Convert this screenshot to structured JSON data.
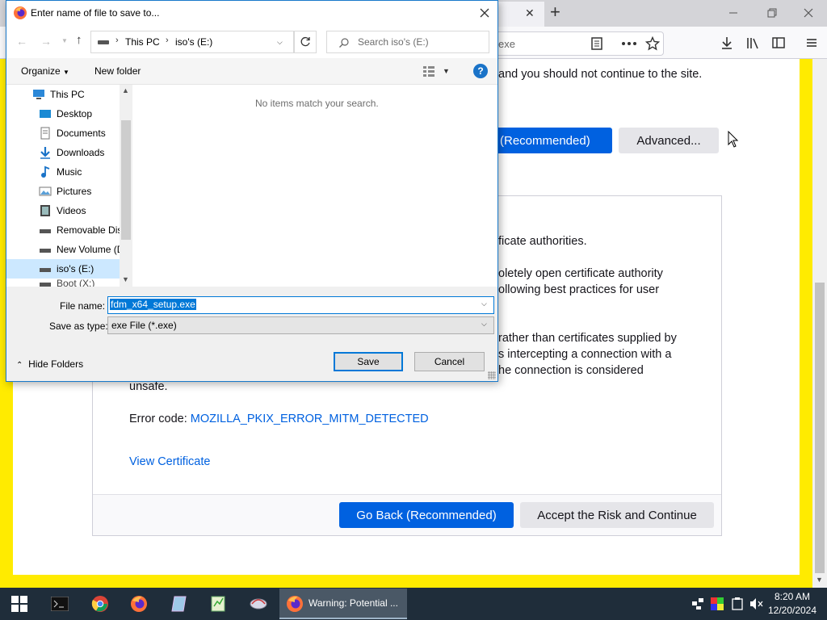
{
  "browser": {
    "tab_close": "✕",
    "new_tab": "+",
    "url_fragment": "exe",
    "warning_line": "and you should not continue to the site.",
    "accept_partial": "(Recommended)",
    "advanced_label": "Advanced...",
    "paragraphs": [
      "ficate authorities.",
      "oletely open certificate authority",
      "ollowing best practices for user",
      "rather than certificates supplied by",
      "s intercepting a connection with a",
      "he connection is considered",
      "unsafe."
    ],
    "error_code_label": "Error code:",
    "error_code": "MOZILLA_PKIX_ERROR_MITM_DETECTED",
    "view_certificate": "View Certificate",
    "go_back": "Go Back (Recommended)",
    "accept_risk": "Accept the Risk and Continue"
  },
  "dialog": {
    "title": "Enter name of file to save to...",
    "breadcrumb": [
      "This PC",
      "iso's (E:)"
    ],
    "search_placeholder": "Search iso's (E:)",
    "organize": "Organize",
    "new_folder": "New folder",
    "empty_message": "No items match your search.",
    "nav_items": [
      {
        "label": "This PC",
        "icon": "computer-icon"
      },
      {
        "label": "Desktop",
        "icon": "desktop-folder-icon"
      },
      {
        "label": "Documents",
        "icon": "documents-folder-icon"
      },
      {
        "label": "Downloads",
        "icon": "downloads-folder-icon"
      },
      {
        "label": "Music",
        "icon": "music-folder-icon"
      },
      {
        "label": "Pictures",
        "icon": "pictures-folder-icon"
      },
      {
        "label": "Videos",
        "icon": "videos-folder-icon"
      },
      {
        "label": "Removable Dis",
        "icon": "drive-icon"
      },
      {
        "label": "New Volume (D",
        "icon": "drive-icon"
      },
      {
        "label": "iso's (E:)",
        "icon": "drive-icon"
      },
      {
        "label": "Boot (X:)",
        "icon": "drive-icon"
      }
    ],
    "file_name_label": "File name:",
    "file_name_value": "fdm_x64_setup.exe",
    "save_type_label": "Save as type:",
    "save_type_value": "exe File (*.exe)",
    "hide_folders": "Hide Folders",
    "save": "Save",
    "cancel": "Cancel"
  },
  "taskbar": {
    "active_window": "Warning: Potential ...",
    "time": "8:20 AM",
    "date": "12/20/2024"
  },
  "colors": {
    "accent_blue": "#0061e0",
    "warning_border": "#ffeb00",
    "dialog_border": "#1979ca"
  }
}
